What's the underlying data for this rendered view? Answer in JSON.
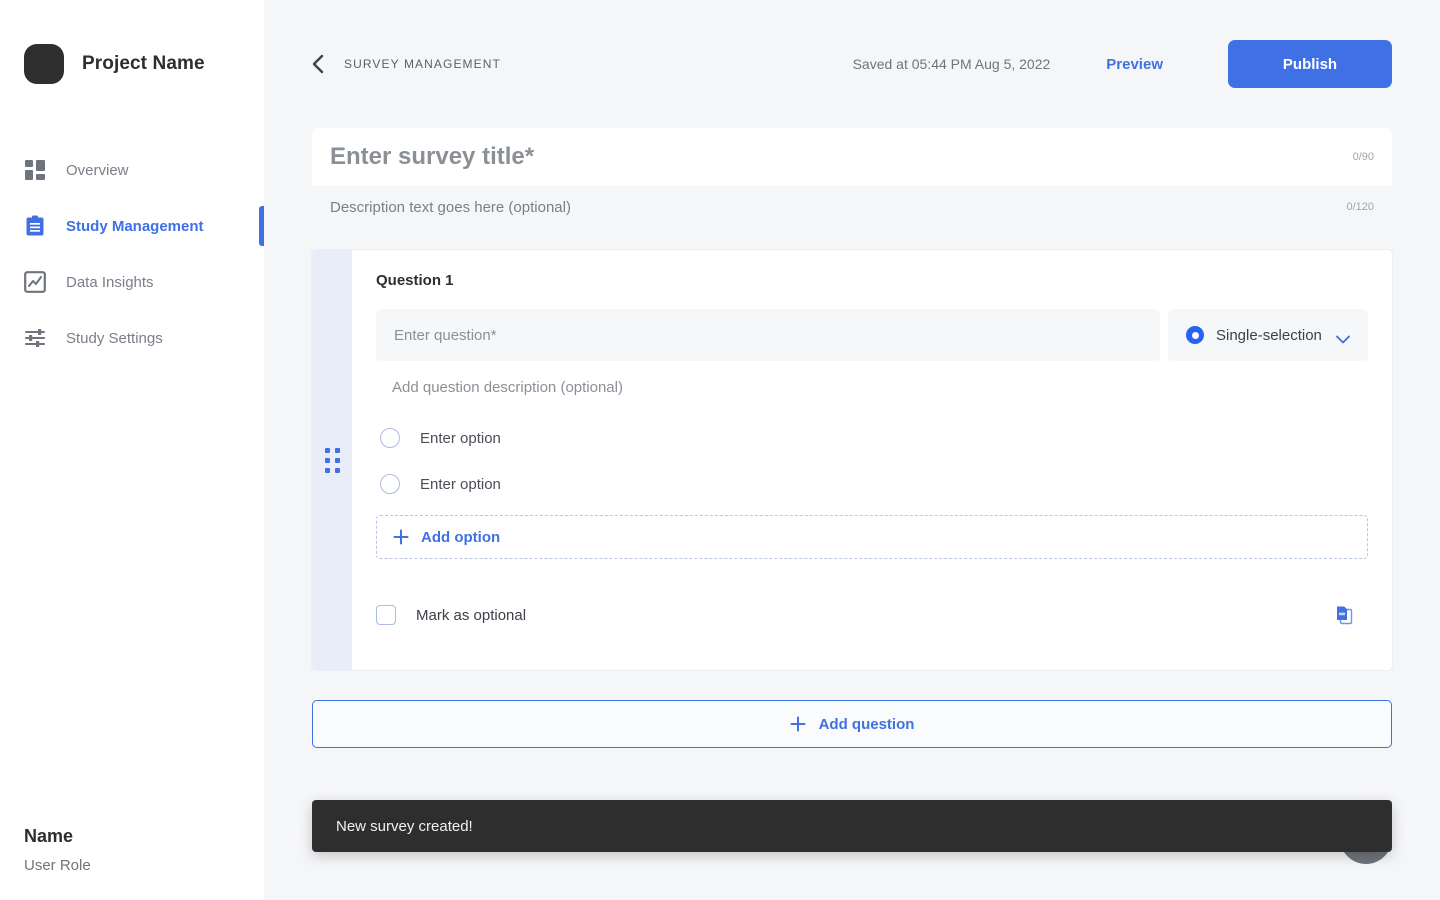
{
  "sidebar": {
    "brand": {
      "name": "Project Name",
      "logo_icon": "squircle-logo"
    },
    "items": [
      {
        "label": "Overview",
        "icon": "dashboard-icon",
        "active": false
      },
      {
        "label": "Study Management",
        "icon": "clipboard-icon",
        "active": true
      },
      {
        "label": "Data Insights",
        "icon": "chart-icon",
        "active": false
      },
      {
        "label": "Study Settings",
        "icon": "sliders-icon",
        "active": false
      }
    ],
    "footer": {
      "name": "Name",
      "role": "User Role"
    }
  },
  "topbar": {
    "back_icon": "chevron-left-icon",
    "breadcrumb": "SURVEY MANAGEMENT",
    "saved_text": "Saved at 05:44 PM Aug 5, 2022",
    "preview_label": "Preview",
    "publish_label": "Publish"
  },
  "survey": {
    "title_value": "",
    "title_placeholder": "Enter survey title*",
    "title_counter": "0/90",
    "description_value": "",
    "description_placeholder": "Description text goes here (optional)",
    "description_counter": "0/120"
  },
  "question": {
    "heading": "Question 1",
    "drag_handle_icon": "drag-handle-icon",
    "input_value": "",
    "input_placeholder": "Enter question*",
    "type_label": "Single-selection",
    "type_icon": "radio-filled-icon",
    "type_chevron_icon": "chevron-down-icon",
    "desc_value": "",
    "desc_placeholder": "Add question description (optional)",
    "options": [
      {
        "value": "",
        "placeholder": "Enter option",
        "icon": "radio-empty-icon"
      },
      {
        "value": "",
        "placeholder": "Enter option",
        "icon": "radio-empty-icon"
      }
    ],
    "add_option_label": "Add option",
    "add_option_icon": "plus-icon",
    "optional_label": "Mark as optional",
    "optional_checked": false,
    "duplicate_icon": "duplicate-icon"
  },
  "actions": {
    "add_question_label": "Add question",
    "add_question_icon": "plus-icon",
    "fab_icon": "help-fab-icon"
  },
  "toast": {
    "message": "New survey created!"
  },
  "colors": {
    "accent": "#4071e4",
    "accent_strong": "#2563f0",
    "page_bg": "#f5f6f8",
    "card_bg": "#ffffff",
    "drag_strip": "#e9edf9",
    "toast_bg": "#2e2e2e",
    "text_primary": "#2e2e2e",
    "text_muted": "#7b7f87"
  }
}
